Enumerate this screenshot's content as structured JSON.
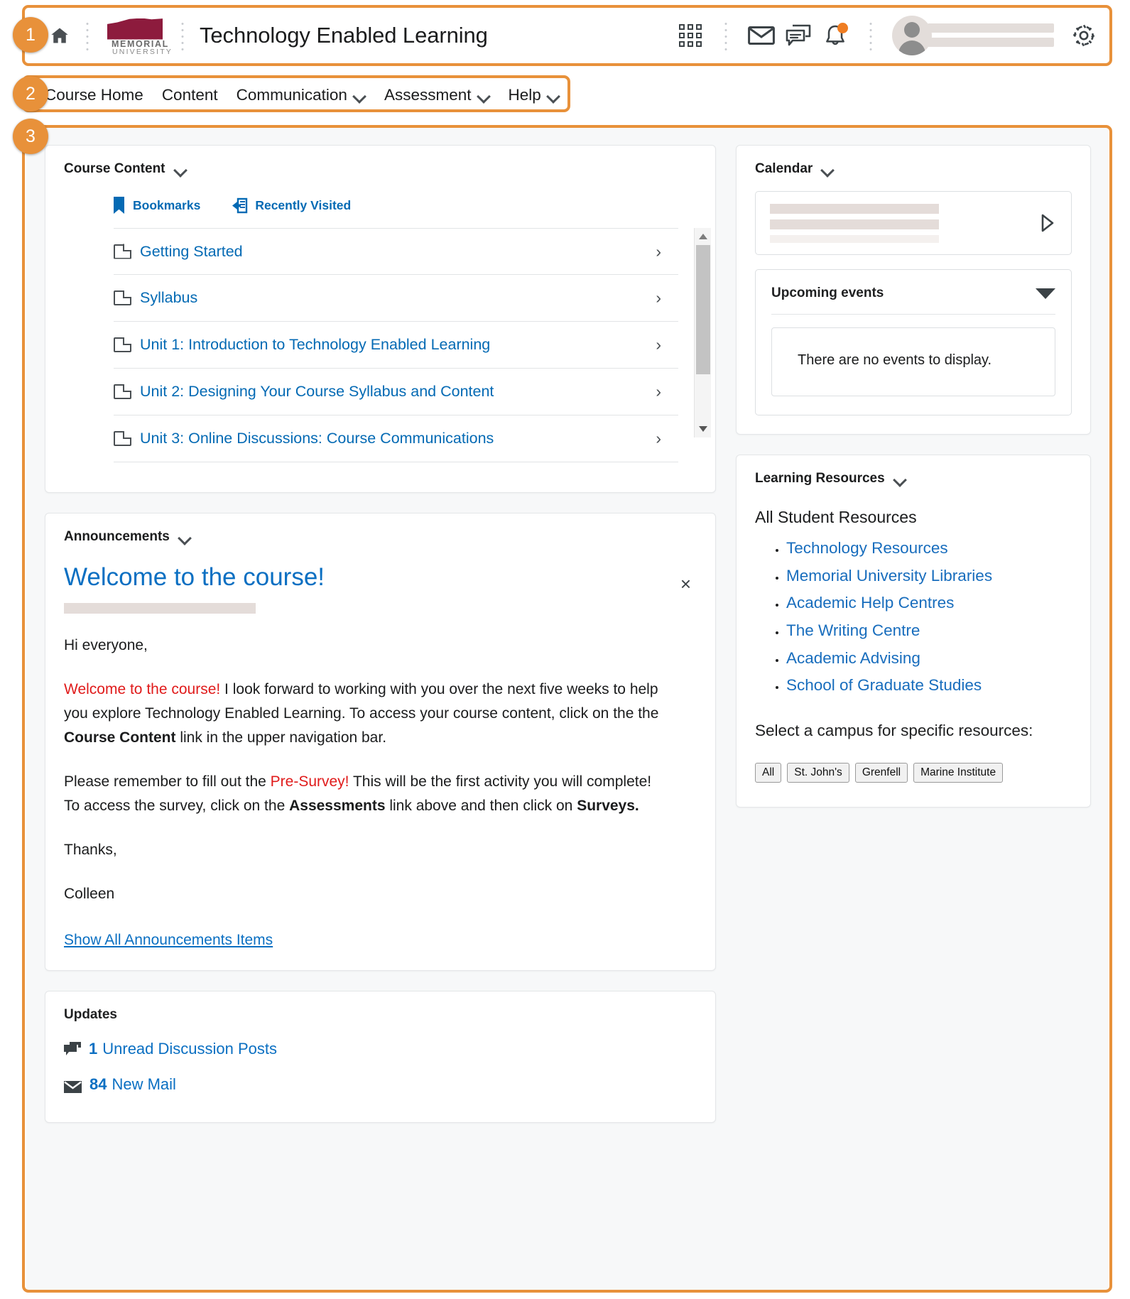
{
  "callouts": [
    {
      "number": "1"
    },
    {
      "number": "2"
    },
    {
      "number": "3"
    }
  ],
  "header": {
    "home_icon": "home-icon",
    "logo_line1": "MEMORIAL",
    "logo_line2": "UNIVERSITY",
    "title": "Technology Enabled Learning",
    "icons": [
      {
        "name": "waffle-apps-icon",
        "label": "Apps"
      },
      {
        "name": "mail-icon",
        "label": "Email"
      },
      {
        "name": "chat-icon",
        "label": "Messages"
      },
      {
        "name": "bell-icon",
        "label": "Notifications",
        "has_badge": true
      }
    ],
    "settings_icon": "gear-icon"
  },
  "navbar": {
    "items": [
      {
        "label": "Course Home",
        "has_caret": false
      },
      {
        "label": "Content",
        "has_caret": false
      },
      {
        "label": "Communication",
        "has_caret": true
      },
      {
        "label": "Assessment",
        "has_caret": true
      },
      {
        "label": "Help",
        "has_caret": true
      }
    ]
  },
  "course_content": {
    "title": "Course Content",
    "tabs": [
      {
        "label": "Bookmarks",
        "icon": "bookmark-icon"
      },
      {
        "label": "Recently Visited",
        "icon": "recently-visited-icon"
      }
    ],
    "items": [
      {
        "label": "Getting Started"
      },
      {
        "label": "Syllabus"
      },
      {
        "label": "Unit 1: Introduction to Technology Enabled Learning"
      },
      {
        "label": "Unit 2: Designing Your Course Syllabus and Content"
      },
      {
        "label": "Unit 3: Online Discussions: Course Communications"
      }
    ],
    "chevron_glyph": "›"
  },
  "announcements": {
    "widget_title": "Announcements",
    "headline": "Welcome to the course!",
    "close_glyph": "×",
    "greeting": "Hi everyone,",
    "para1": {
      "red": "Welcome to the course!",
      "t1": " I look forward to working with you over the next five weeks to help you explore Technology Enabled Learning. To access your course content, click on the the ",
      "bold1": "Course Content",
      "t2": " link in the upper navigation bar."
    },
    "para2": {
      "t0": "Please remember to fill out the ",
      "red": "Pre-Survey!",
      "t1": " This will be the first activity you will complete! To access the survey, click on the ",
      "bold1": "Assessments",
      "t2": " link above and then click on ",
      "bold2": "Surveys."
    },
    "signoff1": "Thanks,",
    "signoff2": "Colleen",
    "show_all": "Show All Announcements Items"
  },
  "updates": {
    "title": "Updates",
    "rows": [
      {
        "icon": "discussion-icon",
        "count": "1",
        "label": "Unread Discussion Posts"
      },
      {
        "icon": "mail-icon",
        "count": "84",
        "label": "New Mail"
      }
    ]
  },
  "calendar": {
    "title": "Calendar",
    "play_icon": "play-icon",
    "upcoming_title": "Upcoming events",
    "no_events": "There are no events to display."
  },
  "learning_resources": {
    "title": "Learning Resources",
    "subtitle": "All Student Resources",
    "links": [
      "Technology Resources",
      "Memorial University Libraries",
      "Academic Help Centres",
      "The Writing Centre",
      "Academic Advising",
      "School of Graduate Studies"
    ],
    "note": "Select a campus for specific resources:",
    "campuses": [
      "All",
      "St. John's",
      "Grenfell",
      "Marine Institute"
    ]
  },
  "colors": {
    "accent_orange": "#e8913a",
    "link_blue": "#046ab4",
    "brand_maroon": "#8d1b3d",
    "alert_red": "#e01b1b",
    "notification_orange": "#ef7d22"
  }
}
